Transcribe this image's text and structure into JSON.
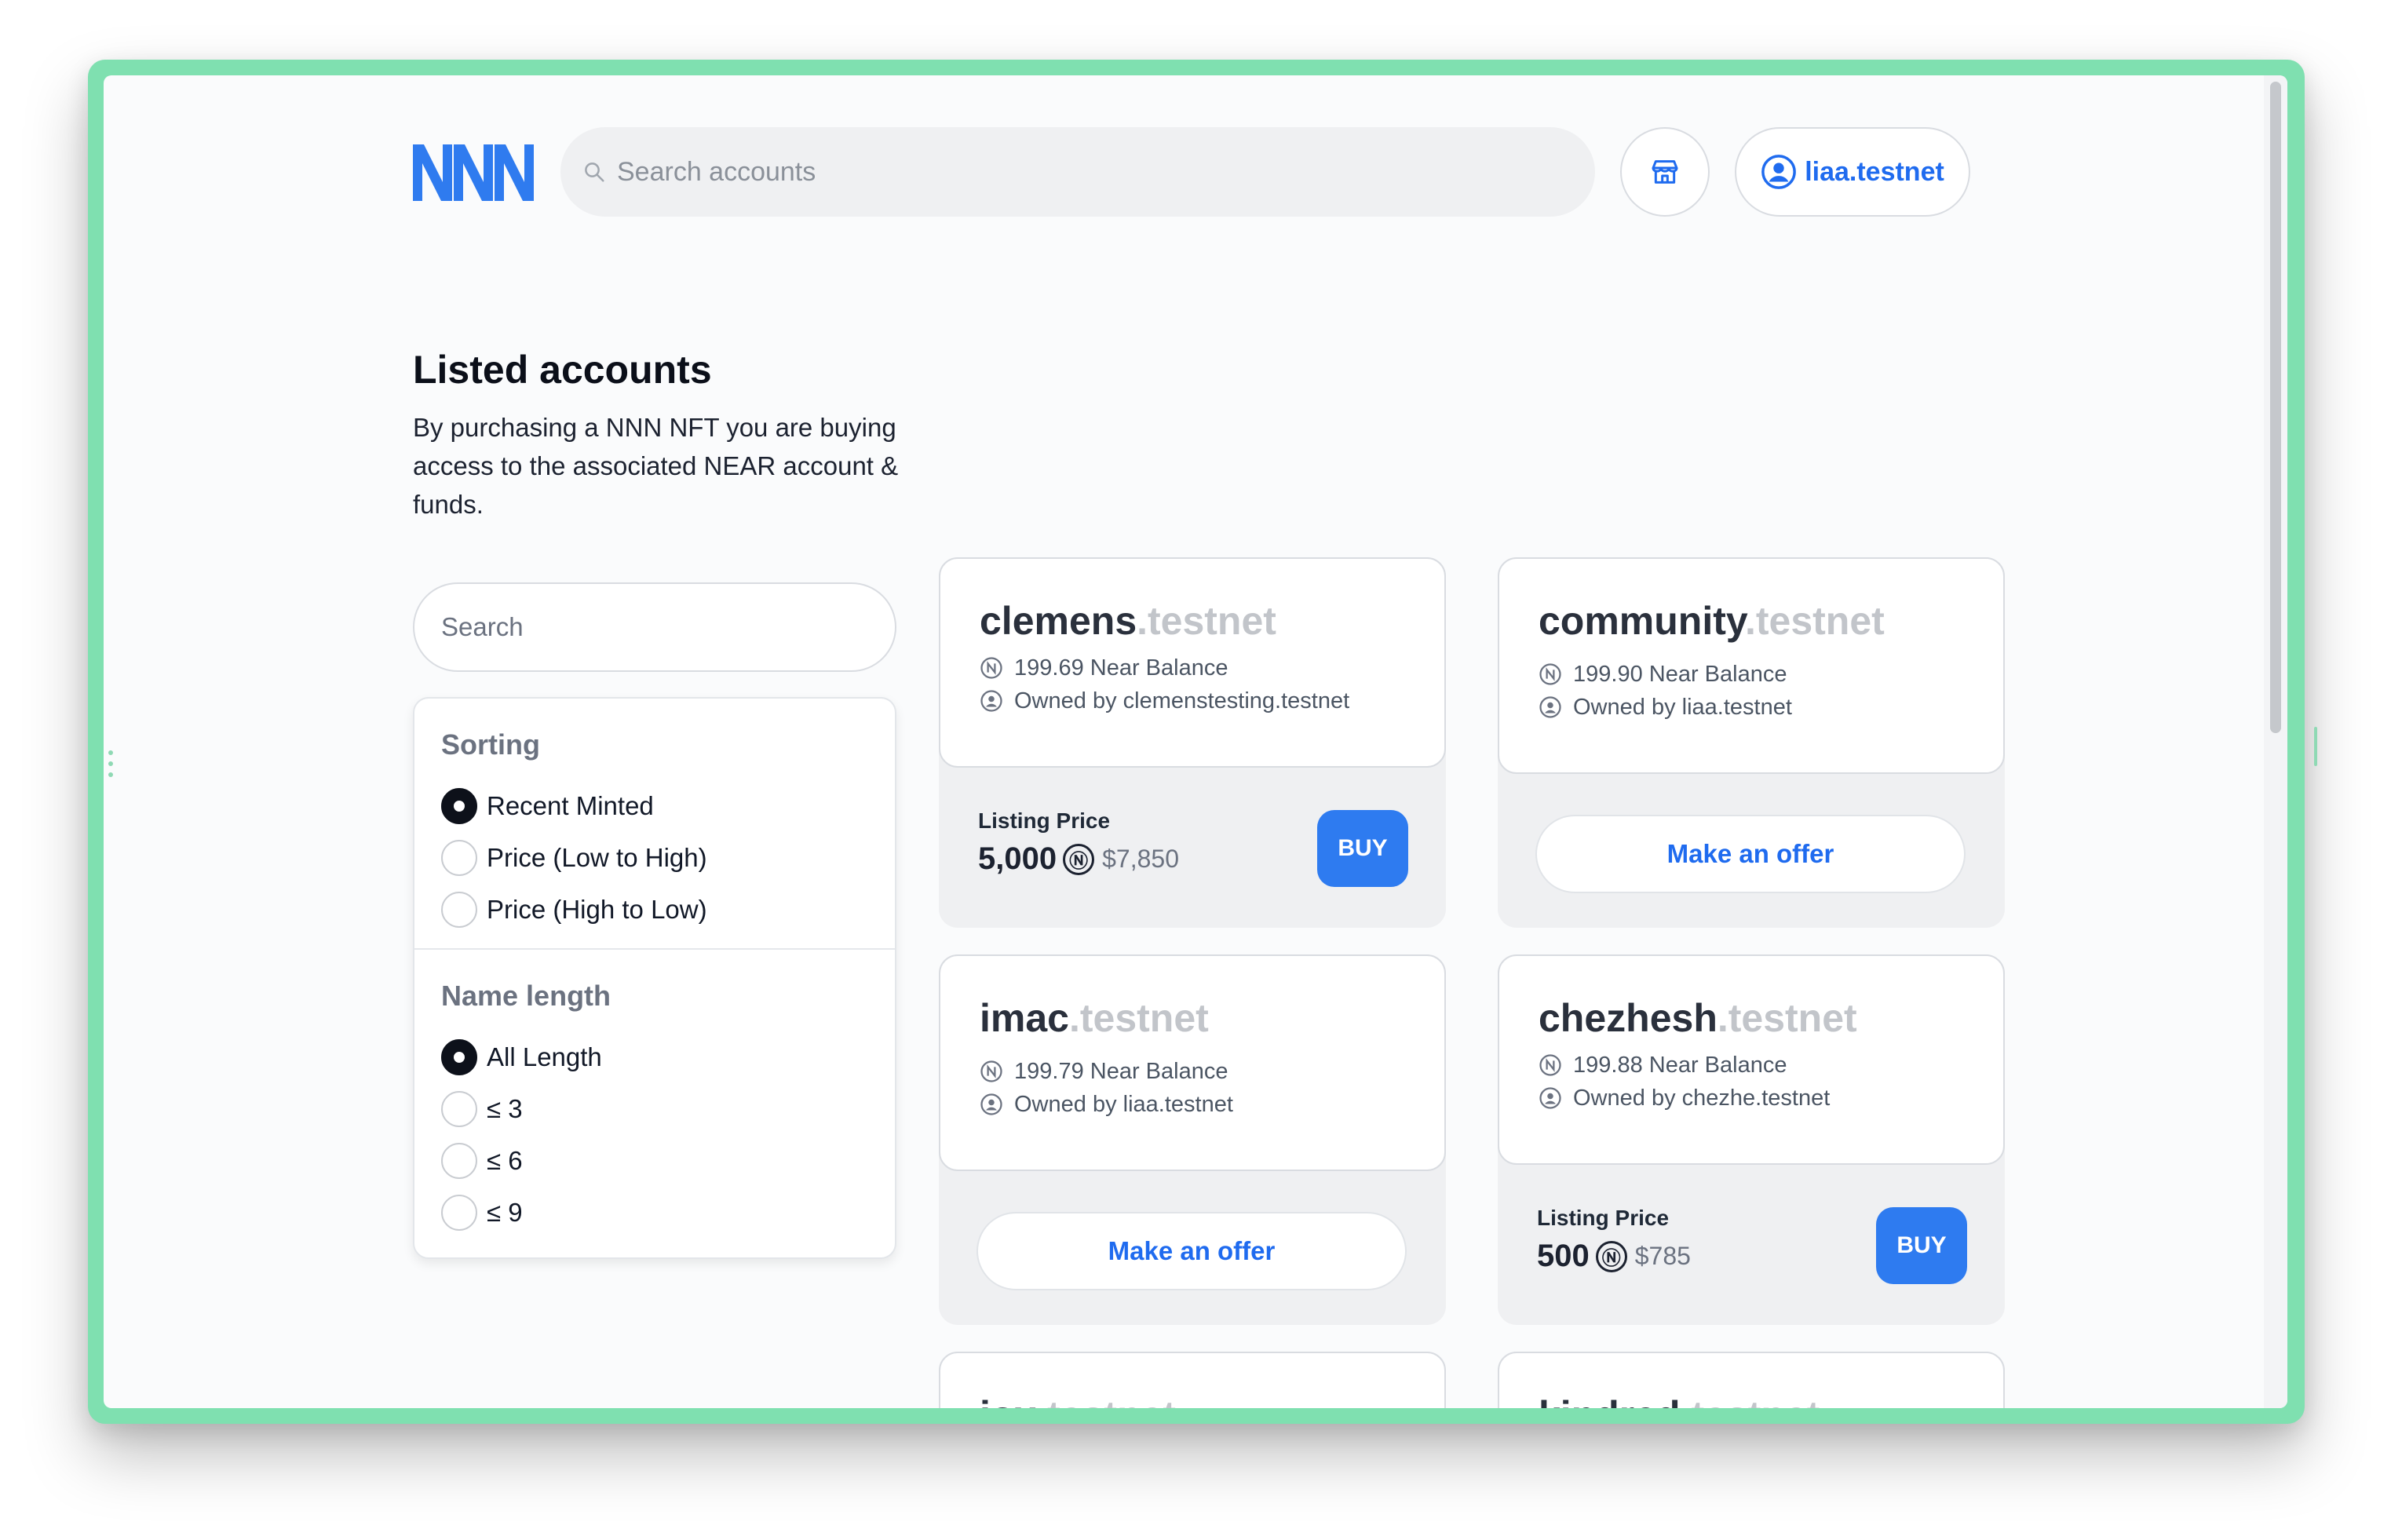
{
  "header": {
    "logo_text": "NNN",
    "search_placeholder": "Search accounts",
    "store_icon": "store-icon",
    "account_label": "liaa.testnet"
  },
  "intro": {
    "title": "Listed accounts",
    "description": "By purchasing a NNN NFT you are buying access to the associated NEAR account & funds."
  },
  "filter": {
    "search_placeholder": "Search",
    "sorting_title": "Sorting",
    "sorting_options": [
      "Recent Minted",
      "Price (Low to High)",
      "Price (High to Low)"
    ],
    "sorting_selected": "Recent Minted",
    "length_title": "Name length",
    "length_options": [
      "All Length",
      "≤ 3",
      "≤ 6",
      "≤ 9"
    ],
    "length_selected": "All Length"
  },
  "cards": [
    {
      "name": "clemens",
      "suffix": ".testnet",
      "balance": "199.69 Near Balance",
      "owner": "Owned by clemenstesting.testnet",
      "listing_label": "Listing Price",
      "price": "5,000",
      "near_symbol": "Ⓝ",
      "usd": "$7,850",
      "buy_label": "BUY"
    },
    {
      "name": "community",
      "suffix": ".testnet",
      "balance": "199.90 Near Balance",
      "owner": "Owned by liaa.testnet",
      "offer_label": "Make an offer"
    },
    {
      "name": "imac",
      "suffix": ".testnet",
      "balance": "199.79 Near Balance",
      "owner": "Owned by liaa.testnet",
      "offer_label": "Make an offer"
    },
    {
      "name": "chezhesh",
      "suffix": ".testnet",
      "balance": "199.88 Near Balance",
      "owner": "Owned by chezhe.testnet",
      "listing_label": "Listing Price",
      "price": "500",
      "near_symbol": "Ⓝ",
      "usd": "$785",
      "buy_label": "BUY"
    },
    {
      "name": "jox",
      "suffix": ".testnet"
    },
    {
      "name": "kindred",
      "suffix": ".testnet"
    }
  ],
  "colors": {
    "accent": "#2e7bf0",
    "frame": "#7fe0b0",
    "logo": "#2f7bef"
  }
}
